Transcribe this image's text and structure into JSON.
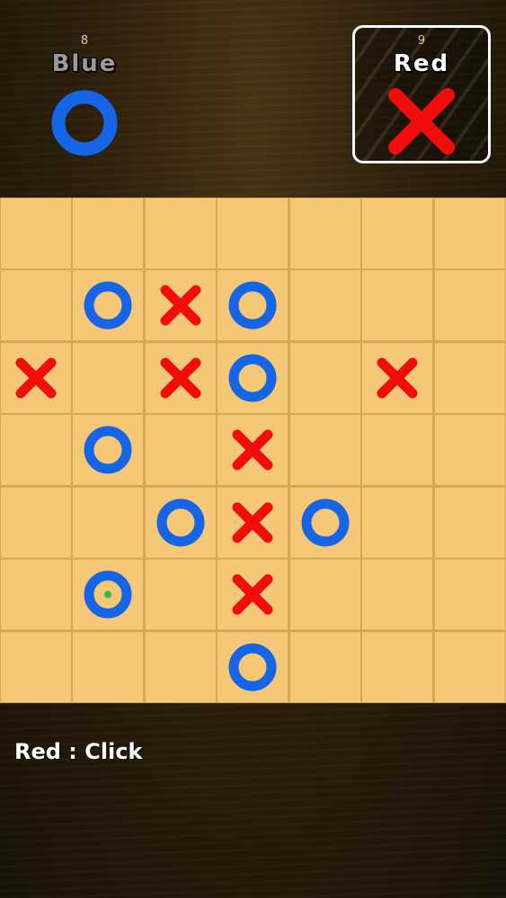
{
  "players": {
    "blue": {
      "name": "Blue",
      "score": "8",
      "mark_icon": "o-icon",
      "color": "#1565e6",
      "active": false
    },
    "red": {
      "name": "Red",
      "score": "9",
      "mark_icon": "x-icon",
      "color": "#f20d0d",
      "active": true
    }
  },
  "board": {
    "rows": 7,
    "cols": 7,
    "cells": [
      [
        "",
        "",
        "",
        "",
        "",
        "",
        ""
      ],
      [
        "",
        "O",
        "X",
        "O",
        "",
        "",
        ""
      ],
      [
        "X",
        "",
        "X",
        "O",
        "",
        "X",
        ""
      ],
      [
        "",
        "O",
        "",
        "X",
        "",
        "",
        ""
      ],
      [
        "",
        "",
        "O",
        "X",
        "O",
        "",
        ""
      ],
      [
        "",
        "O*",
        "",
        "X",
        "",
        "",
        ""
      ],
      [
        "",
        "",
        "",
        "O",
        "",
        "",
        ""
      ]
    ],
    "last_move_marker_color": "#3bb54a"
  },
  "status": {
    "text": "Red : Click"
  },
  "colors": {
    "cell": "#f5c878",
    "grid_line": "#d9a655",
    "x_color": "#f20d0d",
    "o_color": "#1565e6"
  }
}
